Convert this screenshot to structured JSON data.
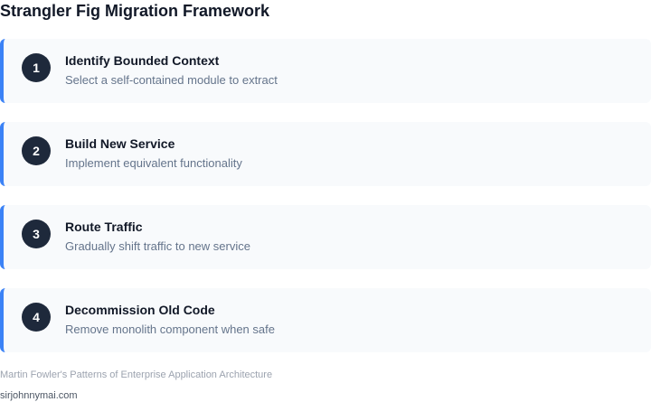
{
  "title": "Strangler Fig Migration Framework",
  "colors": {
    "accent_border": "#3b82f6",
    "number_badge": "#1e293b",
    "card_background": "#f8fafc"
  },
  "steps": [
    {
      "number": "1",
      "title": "Identify Bounded Context",
      "description": "Select a self-contained module to extract"
    },
    {
      "number": "2",
      "title": "Build New Service",
      "description": "Implement equivalent functionality"
    },
    {
      "number": "3",
      "title": "Route Traffic",
      "description": "Gradually shift traffic to new service"
    },
    {
      "number": "4",
      "title": "Decommission Old Code",
      "description": "Remove monolith component when safe"
    }
  ],
  "footer": {
    "source": "Martin Fowler's Patterns of Enterprise Application Architecture",
    "site": "sirjohnnymai.com"
  }
}
